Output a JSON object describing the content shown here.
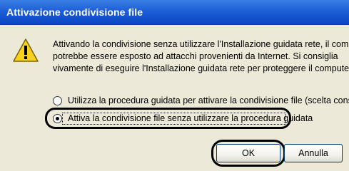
{
  "window": {
    "title": "Attivazione condivisione file"
  },
  "message": {
    "lines": [
      "Attivando la condivisione senza utilizzare l'Installazione guidata rete, il computer",
      "potrebbe essere esposto ad attacchi provenienti da Internet. Si consiglia",
      "vivamente di eseguire l'Installazione guidata rete per proteggere il computer."
    ]
  },
  "options": [
    {
      "label": "Utilizza la procedura guidata per attivare la condivisione file (scelta consigliata)",
      "selected": false
    },
    {
      "label": "Attiva la condivisione file senza utilizzare la procedura guidata",
      "selected": true
    }
  ],
  "buttons": {
    "ok": "OK",
    "cancel": "Annulla"
  },
  "colors": {
    "titlebar": "#1d5fd6",
    "dialog_bg": "#ece9d8",
    "warning_yellow": "#f7d21c"
  },
  "icons": {
    "warning": "warning-icon"
  }
}
